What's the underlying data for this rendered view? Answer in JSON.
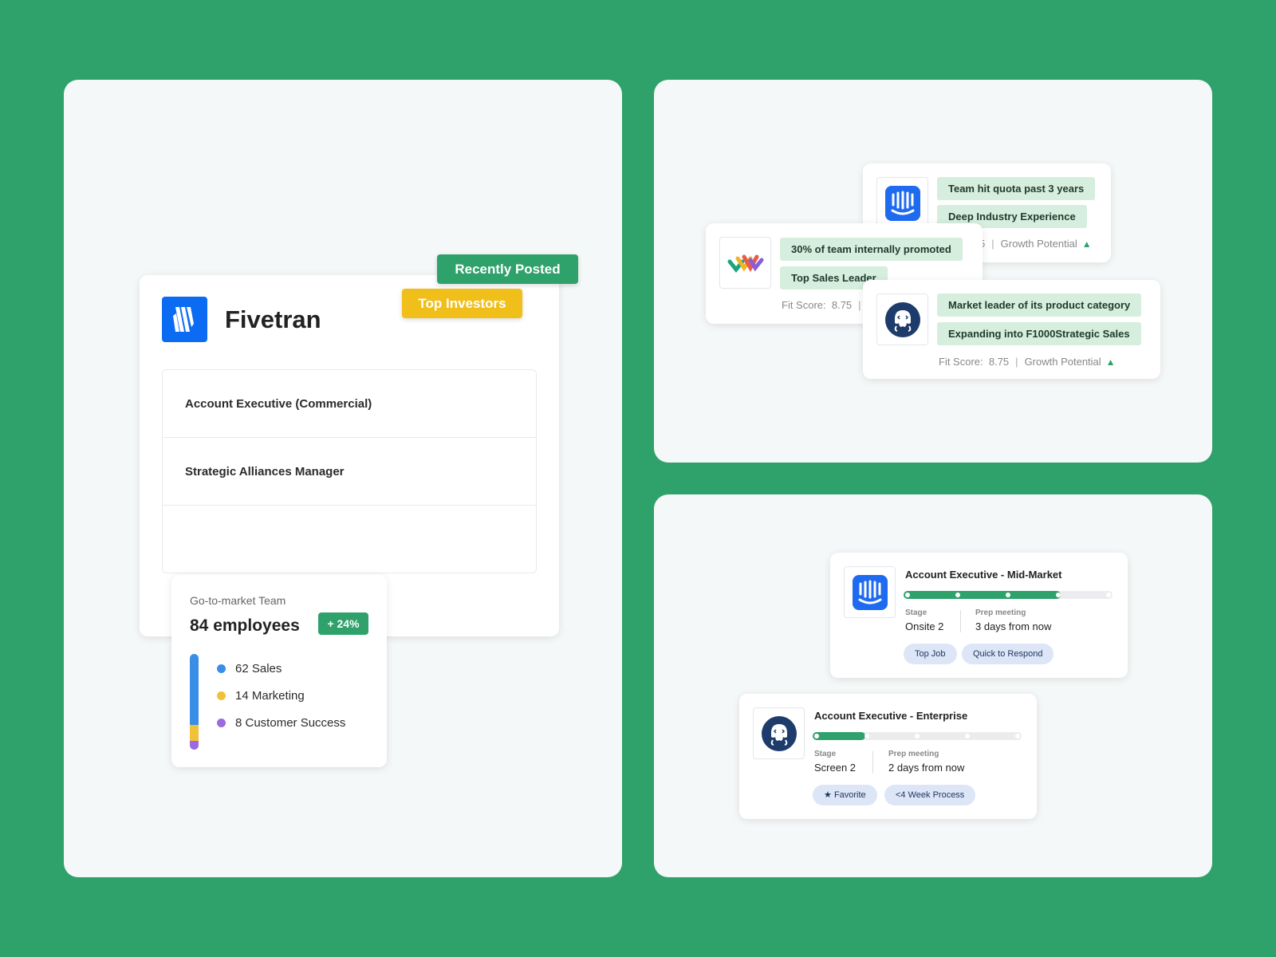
{
  "company": {
    "name": "Fivetran",
    "badges": {
      "recent": "Recently Posted",
      "investors": "Top Investors"
    },
    "jobs": [
      "Account Executive (Commercial)",
      "Strategic Alliances Manager",
      ""
    ]
  },
  "gtm": {
    "title": "Go-to-market Team",
    "count": "84 employees",
    "growth": "+ 24%",
    "breakdown": [
      {
        "label": "62 Sales",
        "value": 62,
        "color": "#3a8ee6"
      },
      {
        "label": "14 Marketing",
        "value": 14,
        "color": "#f0c23a"
      },
      {
        "label": "8 Customer Success",
        "value": 8,
        "color": "#9a6be0"
      }
    ]
  },
  "matches": [
    {
      "logo": "intercom-icon",
      "tags": [
        "Team hit quota past 3 years",
        "Deep Industry Experience"
      ],
      "score_tail": "5",
      "growth": "Growth Potential"
    },
    {
      "logo": "zapier-icon",
      "tags": [
        "30% of team internally promoted",
        "Top Sales Leader"
      ],
      "fit_label": "Fit Score:",
      "fit": "8.75"
    },
    {
      "logo": "octopus-icon",
      "tags": [
        "Market leader of its product category",
        "Expanding into F1000Strategic Sales"
      ],
      "fit_label": "Fit Score:",
      "fit": "8.75",
      "growth": "Growth Potential"
    }
  ],
  "applications": [
    {
      "title": "Account Executive - Mid-Market",
      "progress": 0.75,
      "stage_label": "Stage",
      "stage": "Onsite 2",
      "prep_label": "Prep meeting",
      "prep": "3 days from now",
      "pills": [
        "Top Job",
        "Quick to Respond"
      ]
    },
    {
      "title": "Account Executive - Enterprise",
      "progress": 0.25,
      "stage_label": "Stage",
      "stage": "Screen 2",
      "prep_label": "Prep meeting",
      "prep": "2 days from now",
      "pills": [
        "Favorite",
        "<4 Week Process"
      ]
    }
  ],
  "colors": {
    "brand_green": "#2fa16a",
    "badge_yellow": "#f0bf1a",
    "fivetran_blue": "#0b6bf2",
    "intercom_blue": "#1f6bf0",
    "octopus_navy": "#1d3c6b"
  }
}
